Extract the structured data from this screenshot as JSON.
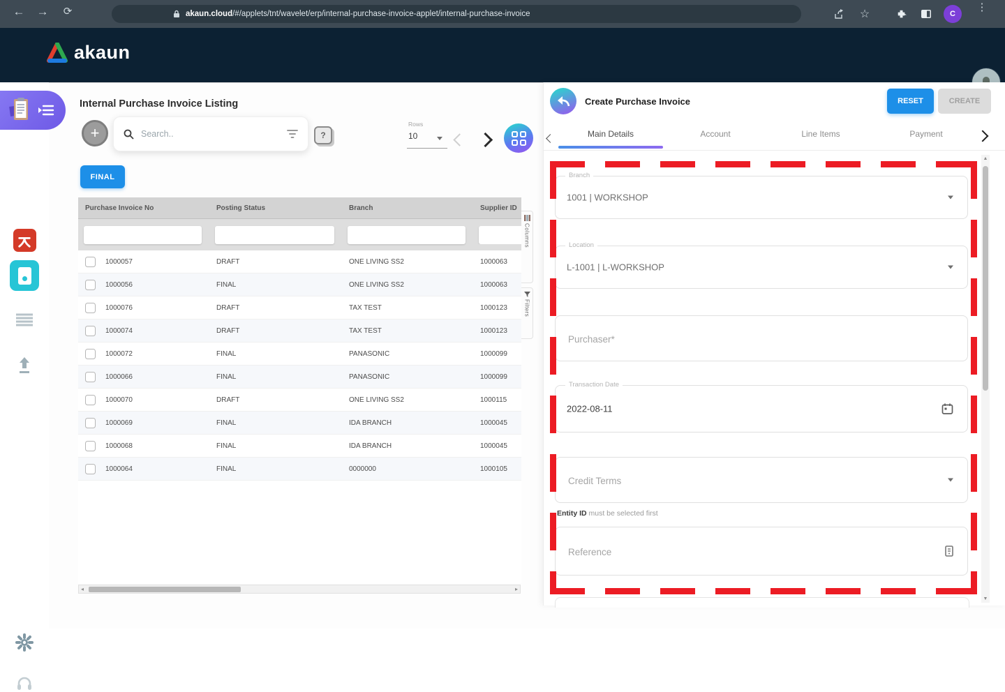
{
  "browser": {
    "url_domain": "akaun.cloud",
    "url_path": "/#/applets/tnt/wavelet/erp/internal-purchase-invoice-applet/internal-purchase-invoice",
    "profile_initial": "C"
  },
  "header": {
    "brand": "akaun"
  },
  "sidebar": {
    "items": [
      {
        "icon": "clipboard-applet-icon",
        "active": true
      },
      {
        "icon": "playlist-menu-icon",
        "active": true
      },
      {
        "icon": "pdf-app-icon"
      },
      {
        "icon": "document-app-icon"
      },
      {
        "icon": "list-icon"
      },
      {
        "icon": "upload-icon"
      },
      {
        "icon": "gear-icon"
      },
      {
        "icon": "headset-icon"
      }
    ]
  },
  "listing": {
    "title": "Internal Purchase Invoice Listing",
    "search_placeholder": "Search..",
    "rows_label": "Rows",
    "rows_value": "10",
    "final_button": "FINAL",
    "side_tabs": {
      "columns": "Columns",
      "filters": "Filters"
    },
    "table": {
      "columns": [
        "Purchase Invoice No",
        "Posting Status",
        "Branch",
        "Supplier ID"
      ],
      "rows": [
        {
          "invoice_no": "1000057",
          "posting_status": "DRAFT",
          "branch": "ONE LIVING SS2",
          "supplier_id": "1000063"
        },
        {
          "invoice_no": "1000056",
          "posting_status": "FINAL",
          "branch": "ONE LIVING SS2",
          "supplier_id": "1000063"
        },
        {
          "invoice_no": "1000076",
          "posting_status": "DRAFT",
          "branch": "TAX TEST",
          "supplier_id": "1000123"
        },
        {
          "invoice_no": "1000074",
          "posting_status": "DRAFT",
          "branch": "TAX TEST",
          "supplier_id": "1000123"
        },
        {
          "invoice_no": "1000072",
          "posting_status": "FINAL",
          "branch": "PANASONIC",
          "supplier_id": "1000099"
        },
        {
          "invoice_no": "1000066",
          "posting_status": "FINAL",
          "branch": "PANASONIC",
          "supplier_id": "1000099"
        },
        {
          "invoice_no": "1000070",
          "posting_status": "DRAFT",
          "branch": "ONE LIVING SS2",
          "supplier_id": "1000115"
        },
        {
          "invoice_no": "1000069",
          "posting_status": "FINAL",
          "branch": "IDA BRANCH",
          "supplier_id": "1000045"
        },
        {
          "invoice_no": "1000068",
          "posting_status": "FINAL",
          "branch": "IDA BRANCH",
          "supplier_id": "1000045"
        },
        {
          "invoice_no": "1000064",
          "posting_status": "FINAL",
          "branch": "0000000",
          "supplier_id": "1000105"
        }
      ]
    }
  },
  "panel": {
    "title": "Create Purchase Invoice",
    "reset_button": "RESET",
    "create_button": "CREATE",
    "tabs": [
      "Main Details",
      "Account",
      "Line Items",
      "Payment"
    ],
    "active_tab": "Main Details",
    "fields": {
      "branch": {
        "label": "Branch",
        "value": "1001 | WORKSHOP"
      },
      "location": {
        "label": "Location",
        "value": "L-1001 | L-WORKSHOP"
      },
      "purchaser": {
        "placeholder": "Purchaser*"
      },
      "transaction_date": {
        "label": "Transaction Date",
        "value": "2022-08-11"
      },
      "credit_terms": {
        "placeholder": "Credit Terms"
      },
      "entity_hint_strong": "Entity ID",
      "entity_hint_rest": " must be selected first",
      "reference": {
        "placeholder": "Reference"
      }
    }
  },
  "colors": {
    "accent_blue": "#1d8fe8",
    "header_navy": "#0c2133",
    "sidebar_purple": "#7a6cf0",
    "teal": "#27c5d6",
    "gradient_teal": "#24ddcb",
    "gradient_purple": "#9a55ef",
    "annotation_red": "#ec1c24"
  }
}
